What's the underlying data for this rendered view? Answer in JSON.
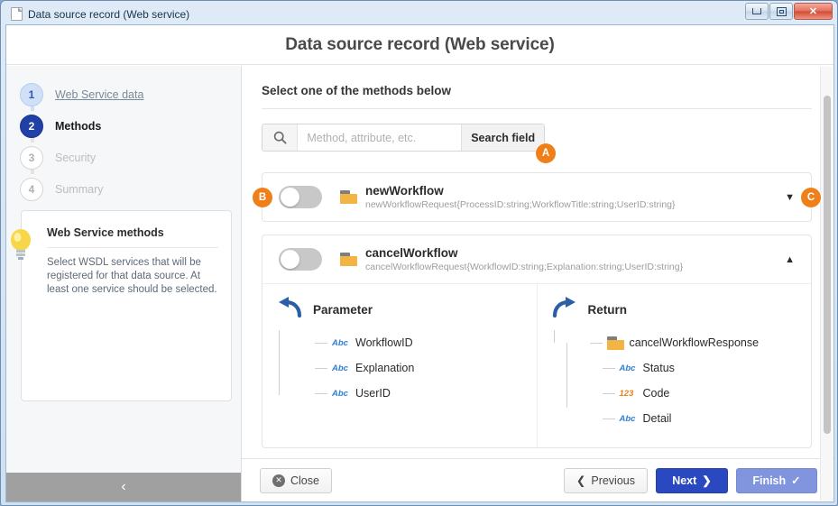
{
  "window": {
    "title": "Data source record (Web service)",
    "doc_icon": "document-icon",
    "minimize_label": "",
    "maximize_label": "",
    "close_label": "✕"
  },
  "app": {
    "title": "Data source record (Web service)"
  },
  "sidebar": {
    "steps": [
      {
        "number": "1",
        "label": "Web Service data",
        "state": "done"
      },
      {
        "number": "2",
        "label": "Methods",
        "state": "active"
      },
      {
        "number": "3",
        "label": "Security",
        "state": "todo"
      },
      {
        "number": "4",
        "label": "Summary",
        "state": "todo"
      }
    ],
    "tip": {
      "icon": "lightbulb-icon",
      "title": "Web Service methods",
      "body": "Select WSDL services that will be registered for that data source. At least one service should be selected."
    },
    "collapse": {
      "icon": "chevron-left-icon",
      "label": "‹"
    }
  },
  "main": {
    "section_title": "Select one of the methods below",
    "search": {
      "icon": "search-icon",
      "placeholder": "Method, attribute, etc.",
      "value": "",
      "button_label": "Search field",
      "badge": "A"
    },
    "badge_toggle": "B",
    "badge_expand": "C",
    "methods": [
      {
        "name": "newWorkflow",
        "signature": "newWorkflowRequest{ProcessID:string;WorkflowTitle:string;UserID:string}",
        "enabled": false,
        "expanded": false,
        "chevron": "▼",
        "folder_icon": "folder-icon"
      },
      {
        "name": "cancelWorkflow",
        "signature": "cancelWorkflowRequest{WorkflowID:string;Explanation:string;UserID:string}",
        "enabled": false,
        "expanded": true,
        "chevron": "▲",
        "folder_icon": "folder-icon",
        "parameter": {
          "icon": "arrow-in-icon",
          "title": "Parameter",
          "nodes": [
            {
              "label": "WorkflowID",
              "type": "Abc"
            },
            {
              "label": "Explanation",
              "type": "Abc"
            },
            {
              "label": "UserID",
              "type": "Abc"
            }
          ]
        },
        "return": {
          "icon": "arrow-out-icon",
          "title": "Return",
          "root": {
            "label": "cancelWorkflowResponse",
            "type": "folder"
          },
          "nodes": [
            {
              "label": "Status",
              "type": "Abc"
            },
            {
              "label": "Code",
              "type": "123"
            },
            {
              "label": "Detail",
              "type": "Abc"
            }
          ]
        }
      }
    ]
  },
  "footer": {
    "close": {
      "label": "Close",
      "icon": "close-circle-icon"
    },
    "previous": {
      "label": "Previous",
      "icon": "chevron-left-icon"
    },
    "next": {
      "label": "Next",
      "icon": "chevron-right-icon"
    },
    "finish": {
      "label": "Finish",
      "icon": "check-icon"
    }
  },
  "colors": {
    "accent_blue": "#2a49c1",
    "badge_orange": "#ef7f18",
    "folder_yellow": "#f2b544",
    "type_blue": "#2e7fd4",
    "type_orange": "#ef7f18"
  }
}
